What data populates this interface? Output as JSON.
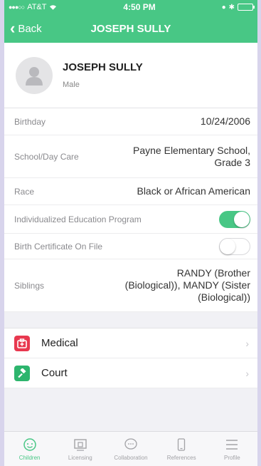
{
  "status_bar": {
    "carrier": "AT&T",
    "time": "4:50 PM"
  },
  "nav": {
    "back_label": "Back",
    "title": "JOSEPH SULLY"
  },
  "profile": {
    "name": "JOSEPH SULLY",
    "gender": "Male"
  },
  "details": {
    "birthday": {
      "label": "Birthday",
      "value": "10/24/2006"
    },
    "school": {
      "label": "School/Day Care",
      "value_line1": "Payne Elementary School,",
      "value_line2": "Grade 3"
    },
    "race": {
      "label": "Race",
      "value": "Black or African American"
    },
    "iep": {
      "label": "Individualized Education Program",
      "checked": true
    },
    "birth_cert": {
      "label": "Birth Certificate On File",
      "checked": false
    },
    "siblings": {
      "label": "Siblings",
      "value_line1": "RANDY (Brother",
      "value_line2": "(Biological)), MANDY (Sister",
      "value_line3": "(Biological))"
    }
  },
  "sections": [
    {
      "label": "Medical",
      "icon": "medical-kit-icon",
      "color": "#e8384f"
    },
    {
      "label": "Court",
      "icon": "gavel-icon",
      "color": "#2db56d"
    }
  ],
  "tabs": [
    {
      "label": "Children",
      "icon": "children-icon",
      "active": true
    },
    {
      "label": "Licensing",
      "icon": "licensing-icon",
      "active": false
    },
    {
      "label": "Collaboration",
      "icon": "chat-icon",
      "active": false
    },
    {
      "label": "References",
      "icon": "phone-icon",
      "active": false
    },
    {
      "label": "Profile",
      "icon": "menu-icon",
      "active": false
    }
  ],
  "colors": {
    "accent": "#48c785",
    "medical": "#e8384f",
    "court": "#2db56d"
  }
}
